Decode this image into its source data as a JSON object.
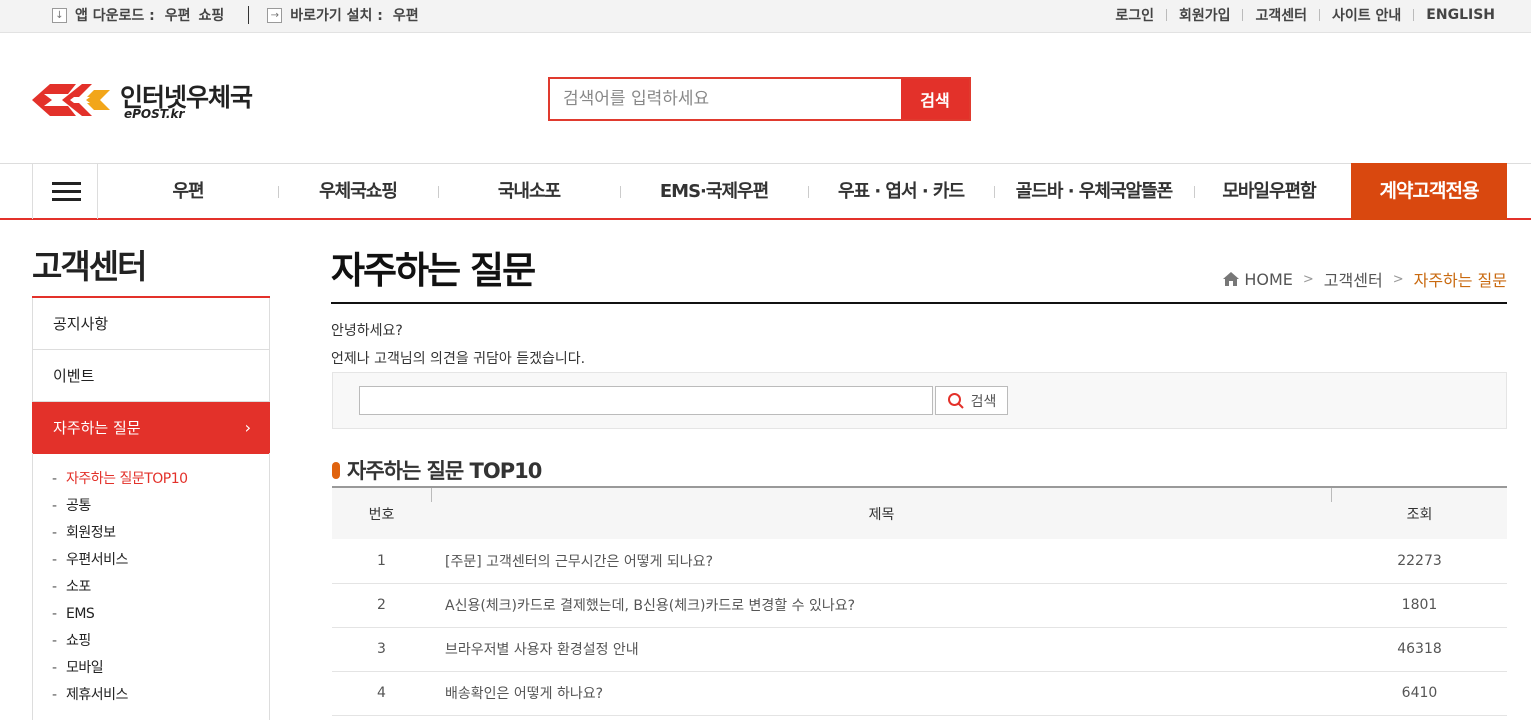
{
  "topbar": {
    "app_download_label": "앱 다운로드 :",
    "app_links": [
      "우편",
      "쇼핑"
    ],
    "shortcut_label": "바로가기 설치 :",
    "shortcut_link": "우편",
    "right_links": [
      "로그인",
      "회원가입",
      "고객센터",
      "사이트 안내",
      "ENGLISH"
    ]
  },
  "header": {
    "logo_name": "인터넷우체국",
    "logo_sub": "ePOST.kr",
    "search_placeholder": "검색어를 입력하세요",
    "search_button": "검색"
  },
  "gnb": {
    "items": [
      "우편",
      "우체국쇼핑",
      "국내소포",
      "EMS·국제우편",
      "우표 · 엽서 · 카드",
      "골드바 · 우체국알뜰폰",
      "모바일우편함"
    ],
    "cta": "계약고객전용"
  },
  "sidebar": {
    "title": "고객센터",
    "menu": [
      "공지사항",
      "이벤트",
      "자주하는 질문"
    ],
    "active_chevron": "›",
    "sub_items": [
      "자주하는 질문TOP10",
      "공통",
      "회원정보",
      "우편서비스",
      "소포",
      "EMS",
      "쇼핑",
      "모바일",
      "제휴서비스"
    ]
  },
  "main": {
    "title": "자주하는 질문",
    "breadcrumb": [
      "HOME",
      "고객센터",
      "자주하는 질문"
    ],
    "greeting_1": "안녕하세요?",
    "greeting_2": "언제나 고객님의 의견을 귀담아 듣겠습니다.",
    "faq_search_button": "검색",
    "section_title": "자주하는 질문 TOP10",
    "table": {
      "headers": [
        "번호",
        "제목",
        "조회"
      ],
      "rows": [
        {
          "num": "1",
          "subject": "[주문] 고객센터의 근무시간은 어떻게 되나요?",
          "views": "22273"
        },
        {
          "num": "2",
          "subject": "A신용(체크)카드로 결제했는데, B신용(체크)카드로 변경할 수 있나요?",
          "views": "1801"
        },
        {
          "num": "3",
          "subject": "브라우저별 사용자 환경설정 안내",
          "views": "46318"
        },
        {
          "num": "4",
          "subject": "배송확인은 어떻게 하나요?",
          "views": "6410"
        }
      ]
    }
  },
  "colors": {
    "brand_red": "#e3312a",
    "cta_orange": "#d9480f",
    "breadcrumb_current": "#c96a10"
  }
}
